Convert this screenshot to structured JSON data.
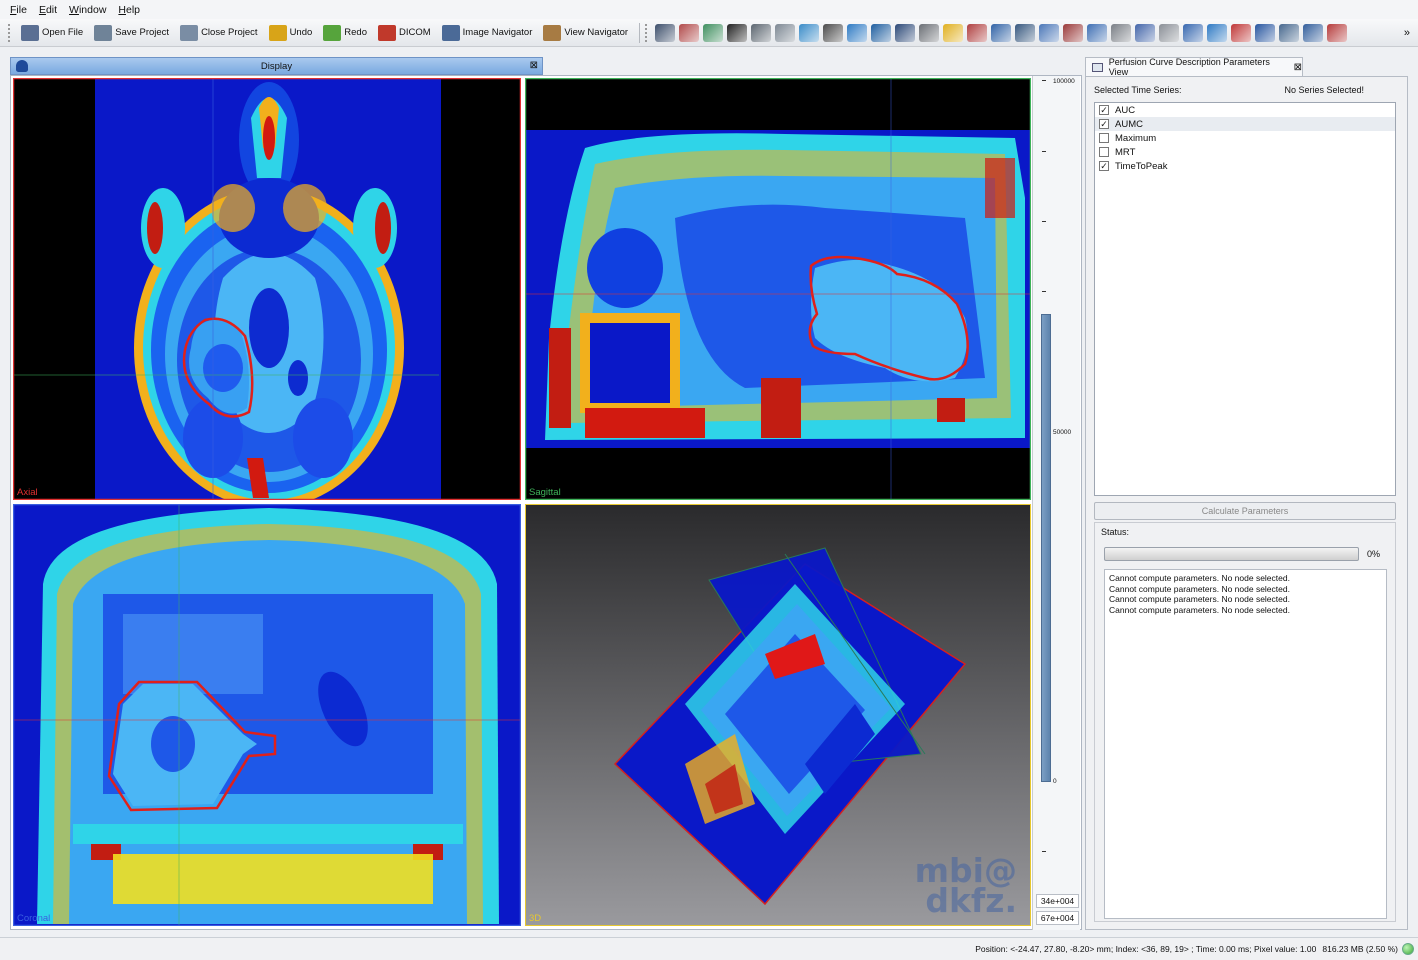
{
  "menu": [
    "File",
    "Edit",
    "Window",
    "Help"
  ],
  "toolbar": {
    "buttons": [
      {
        "label": "Open File",
        "icon": "open-folder-icon",
        "color": "#5a6f93"
      },
      {
        "label": "Save Project",
        "icon": "save-icon",
        "color": "#6f8398"
      },
      {
        "label": "Close Project",
        "icon": "close-project-icon",
        "color": "#7a8da4"
      },
      {
        "label": "Undo",
        "icon": "undo-arrow-icon",
        "color": "#d8a418"
      },
      {
        "label": "Redo",
        "icon": "redo-arrow-icon",
        "color": "#56a43c"
      },
      {
        "label": "DICOM",
        "icon": "dicom-icon",
        "color": "#c0392b"
      },
      {
        "label": "Image Navigator",
        "icon": "sliders-icon",
        "color": "#4b6a97"
      },
      {
        "label": "View Navigator",
        "icon": "view-navigator-icon",
        "color": "#a77b43"
      }
    ],
    "tool_icons": [
      "#3d4f6b",
      "#b14a4a",
      "#3f8f5f",
      "#222222",
      "#5c6670",
      "#7d8893",
      "#3a8cc8",
      "#4b4b4b",
      "#2f7bc4",
      "#1f5fa0",
      "#2d4a78",
      "#6b6f75",
      "#e0b020",
      "#b04040",
      "#3163a6",
      "#37587f",
      "#4b77b8",
      "#9a3a3a",
      "#3f6fb4",
      "#7a7f86",
      "#4466aa",
      "#8a8f96",
      "#3768b0",
      "#2f7ac4",
      "#c03838",
      "#2856a0",
      "#47688e",
      "#335f9c",
      "#b63c3c"
    ],
    "more_label": "»"
  },
  "display": {
    "title": "Display",
    "close_icon": "⊠",
    "views": {
      "axial": "Axial",
      "sagittal": "Sagittal",
      "coronal": "Coronal",
      "three_d": "3D"
    },
    "colors": {
      "axial": "#e03030",
      "sagittal": "#3fb35a",
      "coronal": "#3a5fe0",
      "three_d": "#e6c830"
    },
    "watermark": [
      "mbi@",
      "dkfz."
    ]
  },
  "level_window": {
    "top_label": "100000",
    "mid_label": "50000",
    "bottom_label": "0",
    "level_value": "34e+004",
    "window_value": "67e+004"
  },
  "perfusion_panel": {
    "tab_title": "Perfusion Curve Description Parameters View",
    "close_icon": "⊠",
    "selected_series_label": "Selected Time Series:",
    "selected_series_status": "No Series Selected!",
    "series": [
      {
        "label": "AUC",
        "checked": true
      },
      {
        "label": "AUMC",
        "checked": true
      },
      {
        "label": "Maximum",
        "checked": false
      },
      {
        "label": "MRT",
        "checked": false
      },
      {
        "label": "TimeToPeak",
        "checked": true
      }
    ],
    "calculate_label": "Calculate Parameters",
    "status_label": "Status:",
    "progress": 0,
    "progress_text": "0%",
    "log": [
      "Cannot compute parameters. No node selected.",
      "Cannot compute parameters. No node selected.",
      "Cannot compute parameters. No node selected.",
      "Cannot compute parameters. No node selected."
    ]
  },
  "statusbar": {
    "position": "Position: <-24.47, 27.80, -8.20> mm; Index: <36, 89, 19> ; Time: 0.00 ms; Pixel value: 1.00",
    "memory": "816.23 MB (2.50 %)"
  }
}
